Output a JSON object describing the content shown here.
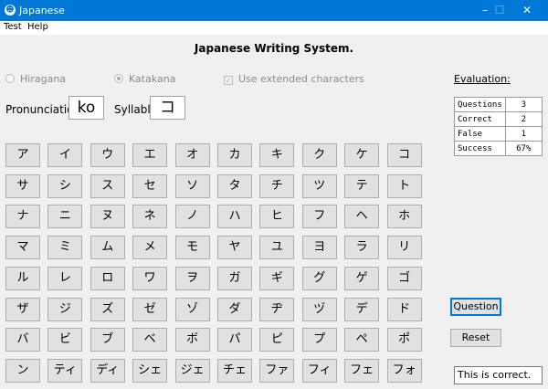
{
  "window": {
    "title": "Japanese",
    "icon": "app-icon",
    "minimize": "–",
    "maximize": "☐",
    "close": "✕"
  },
  "menu": [
    "Test",
    "Help"
  ],
  "heading": "Japanese Writing System.",
  "options": {
    "hiragana": "Hiragana",
    "katakana": "Katakana",
    "extended": "Use extended characters",
    "selected": "Katakana",
    "extended_checked": true
  },
  "pronunciation": {
    "label": "Pronunciation",
    "value": "ko"
  },
  "syllable": {
    "label": "Syllable",
    "value": "コ"
  },
  "evaluation": {
    "title": "Evaluation:",
    "rows": [
      [
        "Questions",
        "3"
      ],
      [
        "Correct",
        "2"
      ],
      [
        "False",
        "1"
      ],
      [
        "Success",
        "67%"
      ]
    ]
  },
  "keys": [
    [
      "ア",
      "イ",
      "ウ",
      "エ",
      "オ",
      "カ",
      "キ",
      "ク",
      "ケ",
      "コ"
    ],
    [
      "サ",
      "シ",
      "ス",
      "セ",
      "ソ",
      "タ",
      "チ",
      "ツ",
      "テ",
      "ト"
    ],
    [
      "ナ",
      "ニ",
      "ヌ",
      "ネ",
      "ノ",
      "ハ",
      "ヒ",
      "フ",
      "ヘ",
      "ホ"
    ],
    [
      "マ",
      "ミ",
      "ム",
      "メ",
      "モ",
      "ヤ",
      "ユ",
      "ヨ",
      "ラ",
      "リ"
    ],
    [
      "ル",
      "レ",
      "ロ",
      "ワ",
      "ヲ",
      "ガ",
      "ギ",
      "グ",
      "ゲ",
      "ゴ"
    ],
    [
      "ザ",
      "ジ",
      "ズ",
      "ゼ",
      "ゾ",
      "ダ",
      "ヂ",
      "ヅ",
      "デ",
      "ド"
    ],
    [
      "バ",
      "ビ",
      "ブ",
      "ベ",
      "ボ",
      "パ",
      "ピ",
      "プ",
      "ペ",
      "ポ"
    ],
    [
      "ン",
      "ティ",
      "ディ",
      "シェ",
      "ジェ",
      "チェ",
      "ファ",
      "フィ",
      "フェ",
      "フォ"
    ]
  ],
  "buttons": {
    "question": "Question",
    "reset": "Reset"
  },
  "status": "This is correct."
}
